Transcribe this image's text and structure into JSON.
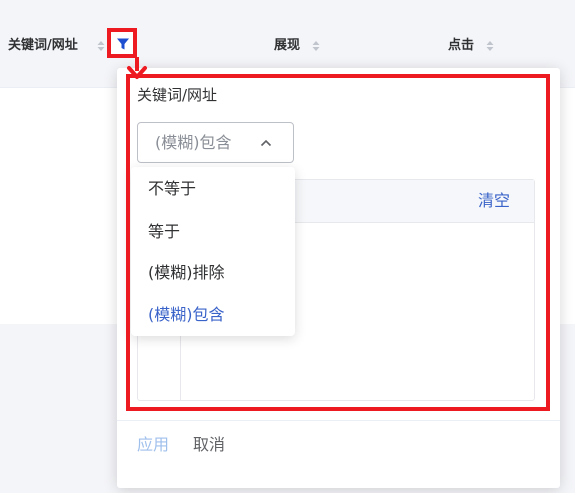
{
  "table": {
    "columns": [
      {
        "label": "关键词/网址"
      },
      {
        "label": "展现"
      },
      {
        "label": "点击"
      }
    ]
  },
  "filter_popover": {
    "title": "关键词/网址",
    "match_select": {
      "selected": "(模糊)包含",
      "options": [
        "不等于",
        "等于",
        "(模糊)排除",
        "(模糊)包含"
      ]
    },
    "clear_label": "清空",
    "apply_label": "应用",
    "cancel_label": "取消"
  },
  "colors": {
    "accent": "#3a63c9",
    "highlight_frame": "#ee1a22",
    "filter_icon": "#1f4fd1"
  },
  "icons": {
    "filter": "funnel-icon",
    "sort": "sort-caret-icon",
    "select_toggle": "chevron-up-icon",
    "callout": "arrow-down-icon"
  }
}
